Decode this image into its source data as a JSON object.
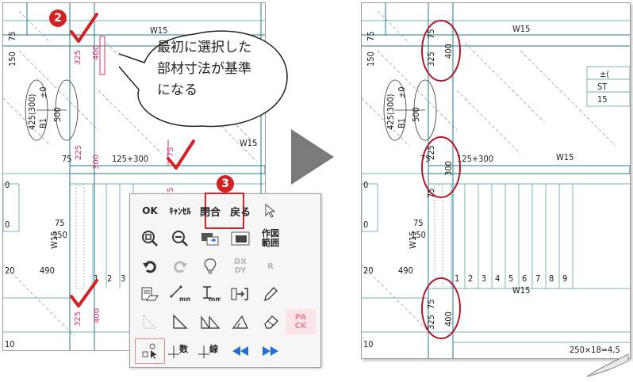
{
  "steps": {
    "step2": "2",
    "step3": "3"
  },
  "callout": {
    "line1": "最初に選択した",
    "line2": "部材寸法が基準",
    "line3": "になる"
  },
  "before": {
    "labels": {
      "w15_top": "W15",
      "w15_mid": "W15",
      "d75_a": "75",
      "d150": "150",
      "d325_a": "325",
      "d400_a": "400",
      "d425": "425(300)",
      "b1": "B1",
      "pm0": "±0",
      "d500": "500",
      "d75_b": "75",
      "d225": "225",
      "d300": "300",
      "d125300": "125+300",
      "d75_c": "75",
      "d75_d": "75",
      "w15_side": "W15",
      "d150_b": "150",
      "d20": "20",
      "d490": "490",
      "n1": "1",
      "n2": "2",
      "n3": "3",
      "d325_b": "325",
      "d400_b": "400",
      "d10": "10"
    }
  },
  "after": {
    "labels": {
      "w15_top": "W15",
      "w15_mid": "W15",
      "w15_low": "W15",
      "d75_a": "75",
      "d150": "150",
      "d325_a": "325",
      "d400_a": "400",
      "d425": "425(300)",
      "b1": "B1",
      "pm0": "±0",
      "d500": "500",
      "d75_b": "75",
      "d225": "225",
      "d300": "300",
      "d125300": "125+300",
      "d75_c": "75",
      "d75_d": "75",
      "w15_side": "W15",
      "d150_b": "150",
      "d20": "20",
      "d490": "490",
      "nums": [
        "1",
        "2",
        "3",
        "4",
        "5",
        "6",
        "7",
        "8",
        "9"
      ],
      "d325_b": "325",
      "d400_b": "400",
      "d10": "10",
      "st": "ST",
      "pm_r": "±(",
      "n15": "15",
      "span": "250×18=4,5"
    }
  },
  "palette": {
    "row1": {
      "ok": "OK",
      "cancel": "ｷｬﾝｾﾙ",
      "close": "閉合",
      "back": "戻る"
    },
    "row2": {
      "drawing_range": "作図\n範囲"
    },
    "row3": {
      "dxdy": "DX\nDY",
      "r": "R"
    },
    "row4": {
      "mm1": "mm",
      "mm2": "mm"
    },
    "row5": {
      "pack": "PA\nCK"
    },
    "row6": {
      "num": "数",
      "line": "線"
    }
  },
  "colors": {
    "accent_red": "#d22222",
    "wall": "#1b7a8c",
    "blue_arrow": "#1f6fd8"
  }
}
